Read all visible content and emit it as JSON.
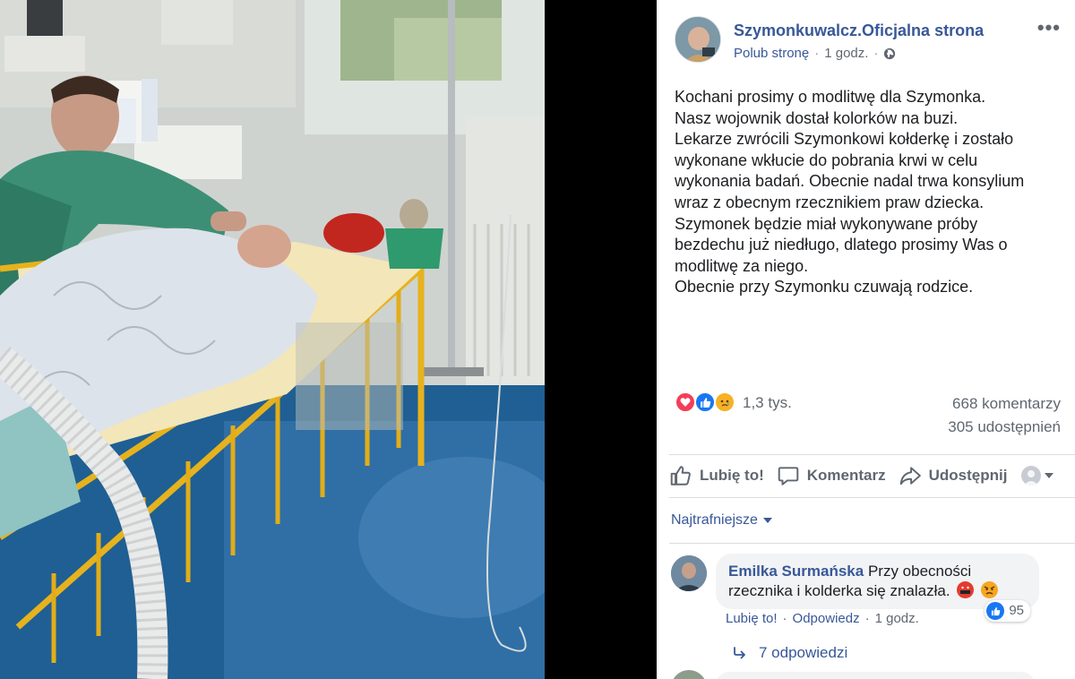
{
  "post": {
    "page_name": "Szymonkuwalcz.Oficjalna strona",
    "like_page": "Polub stronę",
    "separator": "·",
    "time": "1 godz.",
    "separator2": "·",
    "privacy_icon": "globe-icon",
    "more_icon": "more-icon",
    "text_lines": [
      "Kochani prosimy o modlitwę dla Szymonka.",
      "Nasz wojownik dostał kolorków na buzi.",
      "Lekarze zwrócili Szymonkowi kołderkę i zostało",
      "wykonane wkłucie do pobrania krwi w celu",
      "wykonania badań. Obecnie nadal trwa konsylium",
      "wraz z obecnym rzecznikiem praw dziecka.",
      "Szymonek będzie miał wykonywane próby",
      "bezdechu już niedługo, dlatego prosimy Was o",
      "modlitwę za niego.",
      "Obecnie przy Szymonku czuwają rodzice."
    ]
  },
  "stats": {
    "reaction_icons": [
      "love-icon",
      "like-icon",
      "sad-icon"
    ],
    "reactions_count": "1,3 tys.",
    "comments": "668 komentarzy",
    "shares": "305 udostępnień"
  },
  "actions": {
    "like": "Lubię to!",
    "comment": "Komentarz",
    "share": "Udostępnij"
  },
  "sort": {
    "label": "Najtrafniejsze"
  },
  "comment": {
    "author": "Emilka Surmańska",
    "text": "Przy obecności rzecznika i kolderka się znalazła.",
    "emojis": [
      "swearing-face-icon",
      "angry-face-icon"
    ],
    "likes": "95",
    "like_action": "Lubię to!",
    "reply_action": "Odpowiedz",
    "sep": "·",
    "sep2": "·",
    "time": "1 godz.",
    "replies": "7 odpowiedzi"
  },
  "colors": {
    "link": "#385898",
    "secondary": "#606770",
    "like_blue": "#1877f2",
    "love_red": "#f33e58",
    "sad_yellow": "#f7b125"
  }
}
